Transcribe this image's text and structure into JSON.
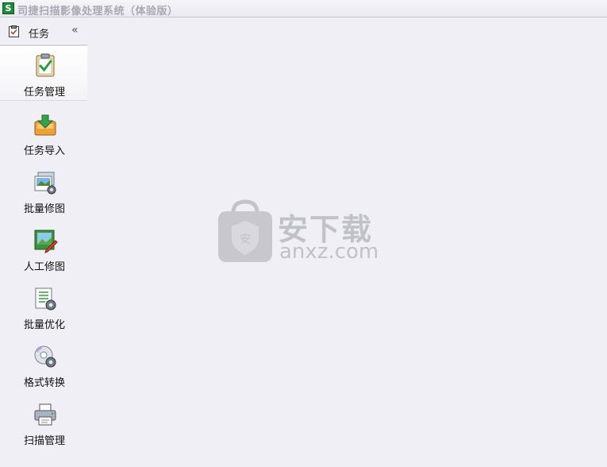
{
  "window": {
    "title": "司捷扫描影像处理系统（体验版）",
    "app_icon_glyph": "S"
  },
  "sidebar": {
    "header_label": "任务",
    "collapse_glyph": "«",
    "items": [
      {
        "label": "任务管理",
        "icon": "clipboard-check-icon",
        "active": true
      },
      {
        "label": "任务导入",
        "icon": "inbox-import-icon",
        "active": false
      },
      {
        "label": "批量修图",
        "icon": "images-gear-icon",
        "active": false
      },
      {
        "label": "人工修图",
        "icon": "picture-edit-icon",
        "active": false
      },
      {
        "label": "批量优化",
        "icon": "document-gear-icon",
        "active": false
      },
      {
        "label": "格式转换",
        "icon": "disc-gear-icon",
        "active": false
      },
      {
        "label": "扫描管理",
        "icon": "printer-icon",
        "active": false
      }
    ]
  },
  "watermark": {
    "main": "安下载",
    "sub": "anxz.com"
  },
  "colors": {
    "background": "#efeff5",
    "accent_green": "#3a9a3a",
    "folder_orange": "#e9a33a"
  }
}
